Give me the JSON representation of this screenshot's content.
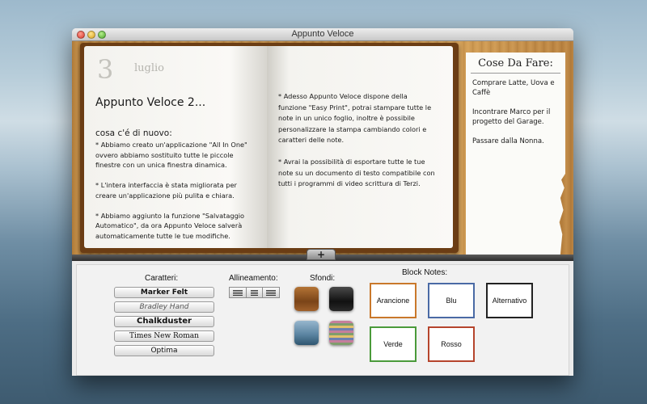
{
  "window": {
    "title": "Appunto Veloce"
  },
  "note": {
    "day": "3",
    "month": "luglio",
    "title": "Appunto Veloce 2...",
    "subtitle": "cosa c'é di nuovo:",
    "left_body": "* Abbiamo creato un'applicazione \"All In One\"\novvero abbiamo sostituito tutte le piccole\nfinestre con un unica finestra dinamica.\n\n* L'intera interfaccia è stata migliorata per\ncreare un'applicazione più pulita e chiara.\n\n* Abbiamo aggiunto la funzione \"Salvataggio\nAutomatico\", da ora Appunto Veloce salverà\nautomaticamente tutte le tue modifiche.",
    "right_body": "* Adesso Appunto Veloce dispone della\nfunzione \"Easy Print\", potrai stampare tutte le\nnote in un unico foglio, inoltre è possibile\npersonalizzare la stampa cambiando colori e\ncaratteri delle note.\n\n* Avrai la possibilità di esportare tutte le tue\nnote su un documento di testo compatibile con\ntutti i programmi di video scrittura di Terzi."
  },
  "todo": {
    "title": "Cose Da Fare:",
    "body": "Comprare Latte, Uova e\nCaffè\n\nIncontrare Marco per il\nprogetto del Garage.\n\nPassare dalla Nonna."
  },
  "add_button": "+",
  "panel": {
    "fonts_label": "Caratteri:",
    "fonts": [
      "Marker Felt",
      "Bradley Hand",
      "Chalkduster",
      "Times New Roman",
      "Optima"
    ],
    "align_label": "Allineamento:",
    "backgrounds_label": "Sfondi:",
    "blocks_label": "Block Notes:",
    "blocks": [
      "Arancione",
      "Blu",
      "Alternativo",
      "Verde",
      "Rosso"
    ]
  }
}
